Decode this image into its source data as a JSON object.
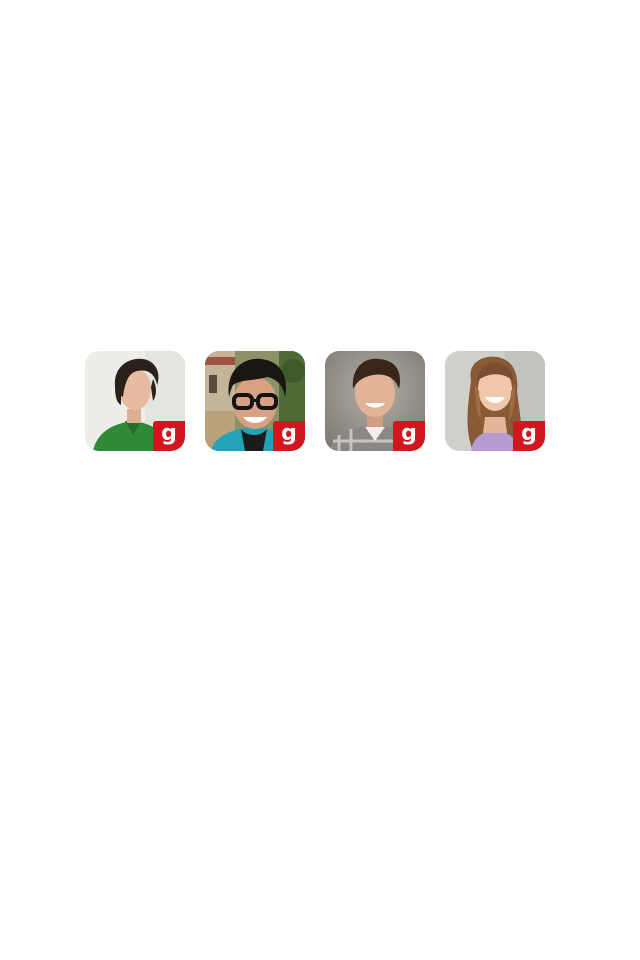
{
  "avatars": [
    {
      "id": "avatar-1",
      "badge_letter": "g",
      "badge_icon": "g-logo-icon",
      "background": "#ecebe8",
      "shirt": "#2f8a38",
      "hair": "#2a211b",
      "skin": "#e7bba0"
    },
    {
      "id": "avatar-2",
      "badge_letter": "g",
      "badge_icon": "g-logo-icon",
      "background": "#6e7f4a",
      "shirt": "#23a3b7",
      "hair": "#1c1613",
      "skin": "#d8a184",
      "glasses": true
    },
    {
      "id": "avatar-3",
      "badge_letter": "g",
      "badge_icon": "g-logo-icon",
      "background": "#9c9891",
      "shirt": "#7c7a78",
      "hair": "#3a2519",
      "skin": "#e2b394"
    },
    {
      "id": "avatar-4",
      "badge_letter": "g",
      "badge_icon": "g-logo-icon",
      "background": "#c9cac6",
      "shirt": "#b69ad2",
      "hair": "#8a5a36",
      "skin": "#efc7aa"
    }
  ],
  "badge_color": "#d0161e",
  "page_background": "#ffffff"
}
